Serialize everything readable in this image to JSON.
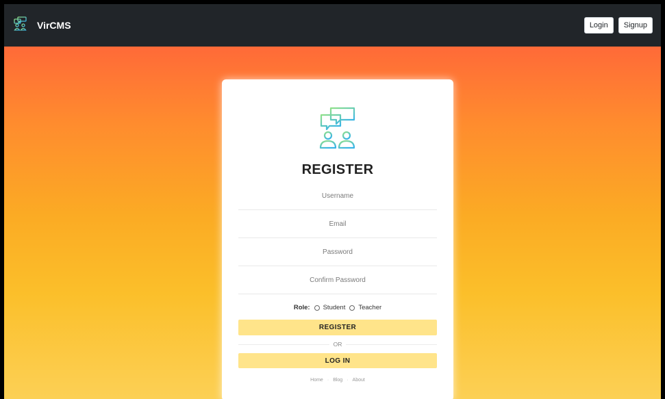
{
  "navbar": {
    "brand": "VirCMS",
    "logo_icon": "chat-users-icon",
    "login_label": "Login",
    "signup_label": "Signup"
  },
  "form": {
    "title": "REGISTER",
    "logo_icon": "chat-users-icon",
    "username_placeholder": "Username",
    "email_placeholder": "Email",
    "password_placeholder": "Password",
    "confirm_password_placeholder": "Confirm Password",
    "role_label": "Role:",
    "role_options": [
      "Student",
      "Teacher"
    ],
    "register_label": "REGISTER",
    "or_text": "OR",
    "login_label": "LOG IN"
  },
  "footer": {
    "links": [
      "Home",
      "Blog",
      "About"
    ],
    "separator": "·"
  },
  "colors": {
    "navbar_bg": "#212529",
    "gradient_top": "#ff6a38",
    "gradient_bottom": "#fcd055",
    "button_bg": "#ffe48a",
    "logo_green": "#7ed17a",
    "logo_blue": "#3ab5e6"
  }
}
